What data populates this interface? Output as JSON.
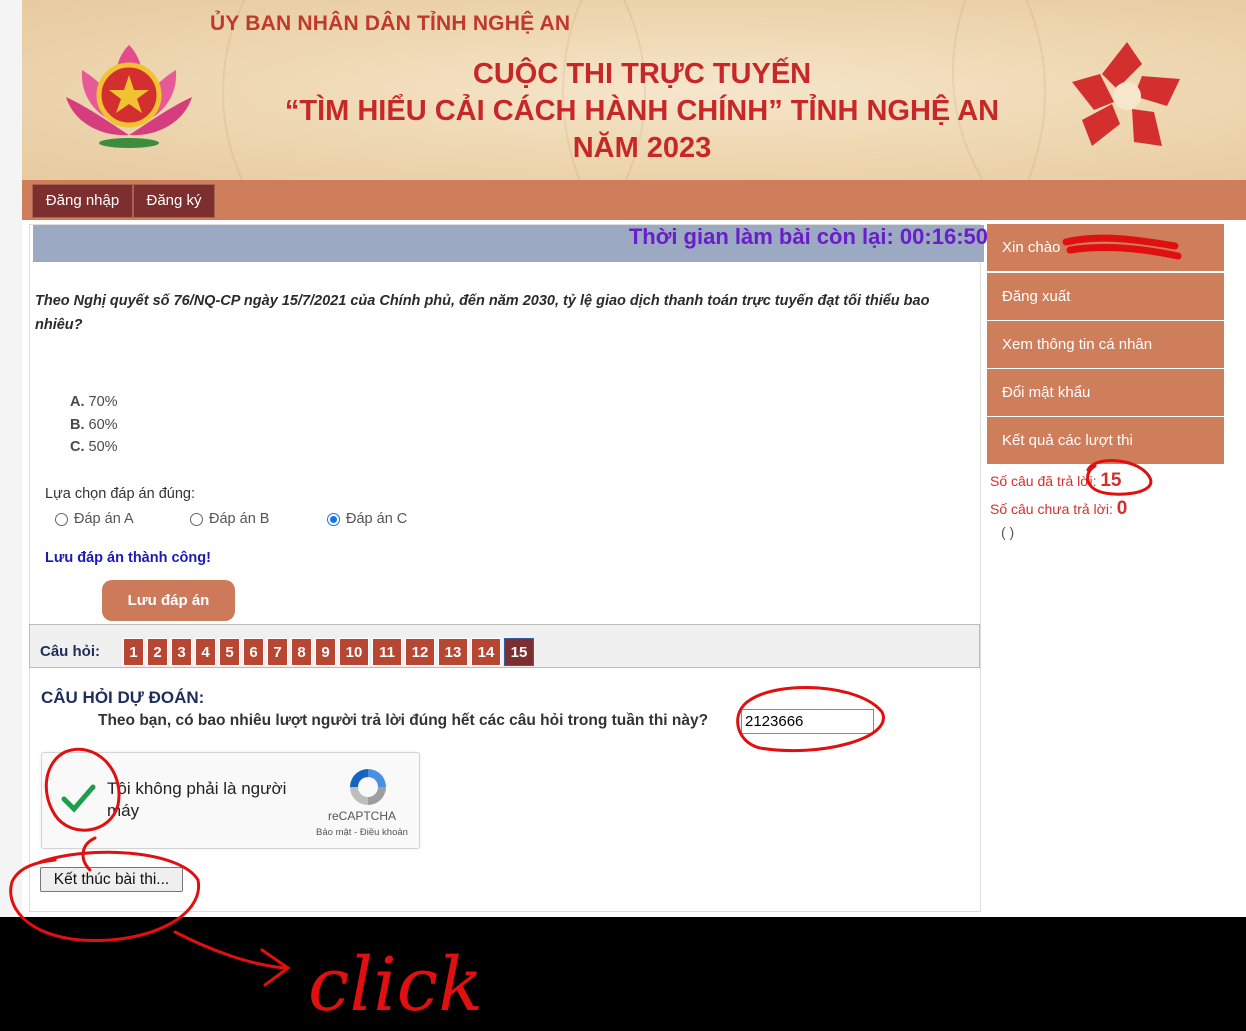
{
  "banner": {
    "org": "ỦY BAN NHÂN DÂN TỈNH NGHỆ AN",
    "title_line1": "CUỘC THI TRỰC TUYẾN",
    "title_line2": "“TÌM HIỂU CẢI CÁCH HÀNH CHÍNH” TỈNH NGHỆ AN",
    "title_line3": "NĂM 2023",
    "left_emblem": "lotus-emblem-icon",
    "right_logo": "cchc-star-logo-icon"
  },
  "nav": {
    "login": "Đăng nhập",
    "register": "Đăng ký"
  },
  "timer": {
    "text": "Thời gian làm bài còn lại: 00:16:50"
  },
  "question": {
    "text": "Theo Nghị quyết số 76/NQ-CP ngày 15/7/2021 của Chính phủ, đến năm 2030, tỷ lệ giao dịch thanh toán trực tuyến đạt tối thiểu bao nhiêu?",
    "options": [
      {
        "key": "A.",
        "value": "70%"
      },
      {
        "key": "B.",
        "value": "60%"
      },
      {
        "key": "C.",
        "value": "50%"
      }
    ]
  },
  "answer": {
    "label": "Lựa chọn đáp án đúng:",
    "choices": [
      "Đáp án A",
      "Đáp án B",
      "Đáp án C"
    ],
    "selected": "Đáp án C",
    "save_message": "Lưu đáp án thành công!",
    "save_button": "Lưu đáp án"
  },
  "question_nav": {
    "label": "Câu hỏi:",
    "numbers": [
      "1",
      "2",
      "3",
      "4",
      "5",
      "6",
      "7",
      "8",
      "9",
      "10",
      "11",
      "12",
      "13",
      "14",
      "15"
    ],
    "current": "15"
  },
  "prediction": {
    "title": "CÂU HỎI DỰ ĐOÁN:",
    "question": "Theo bạn, có bao nhiêu lượt người trả lời đúng hết các câu hỏi trong tuần thi này?",
    "value": "2123666"
  },
  "captcha": {
    "text": "Tôi không phải là người máy",
    "brand": "reCAPTCHA",
    "terms": "Bảo mật - Điều khoản",
    "checked": true
  },
  "finish_button": "Kết thúc bài thi...",
  "sidebar": {
    "greeting": "Xin chào",
    "items": [
      "Đăng xuất",
      "Xem thông tin cá nhân",
      "Đổi mật khẩu",
      "Kết quả các lượt thi"
    ],
    "answered_label": "Số câu đã trả lời:",
    "answered_count": "15",
    "unanswered_label": "Số câu chưa trả lời:",
    "unanswered_count": "0",
    "paren": "( )"
  },
  "annotation": {
    "text": "click",
    "color": "#e01010"
  }
}
